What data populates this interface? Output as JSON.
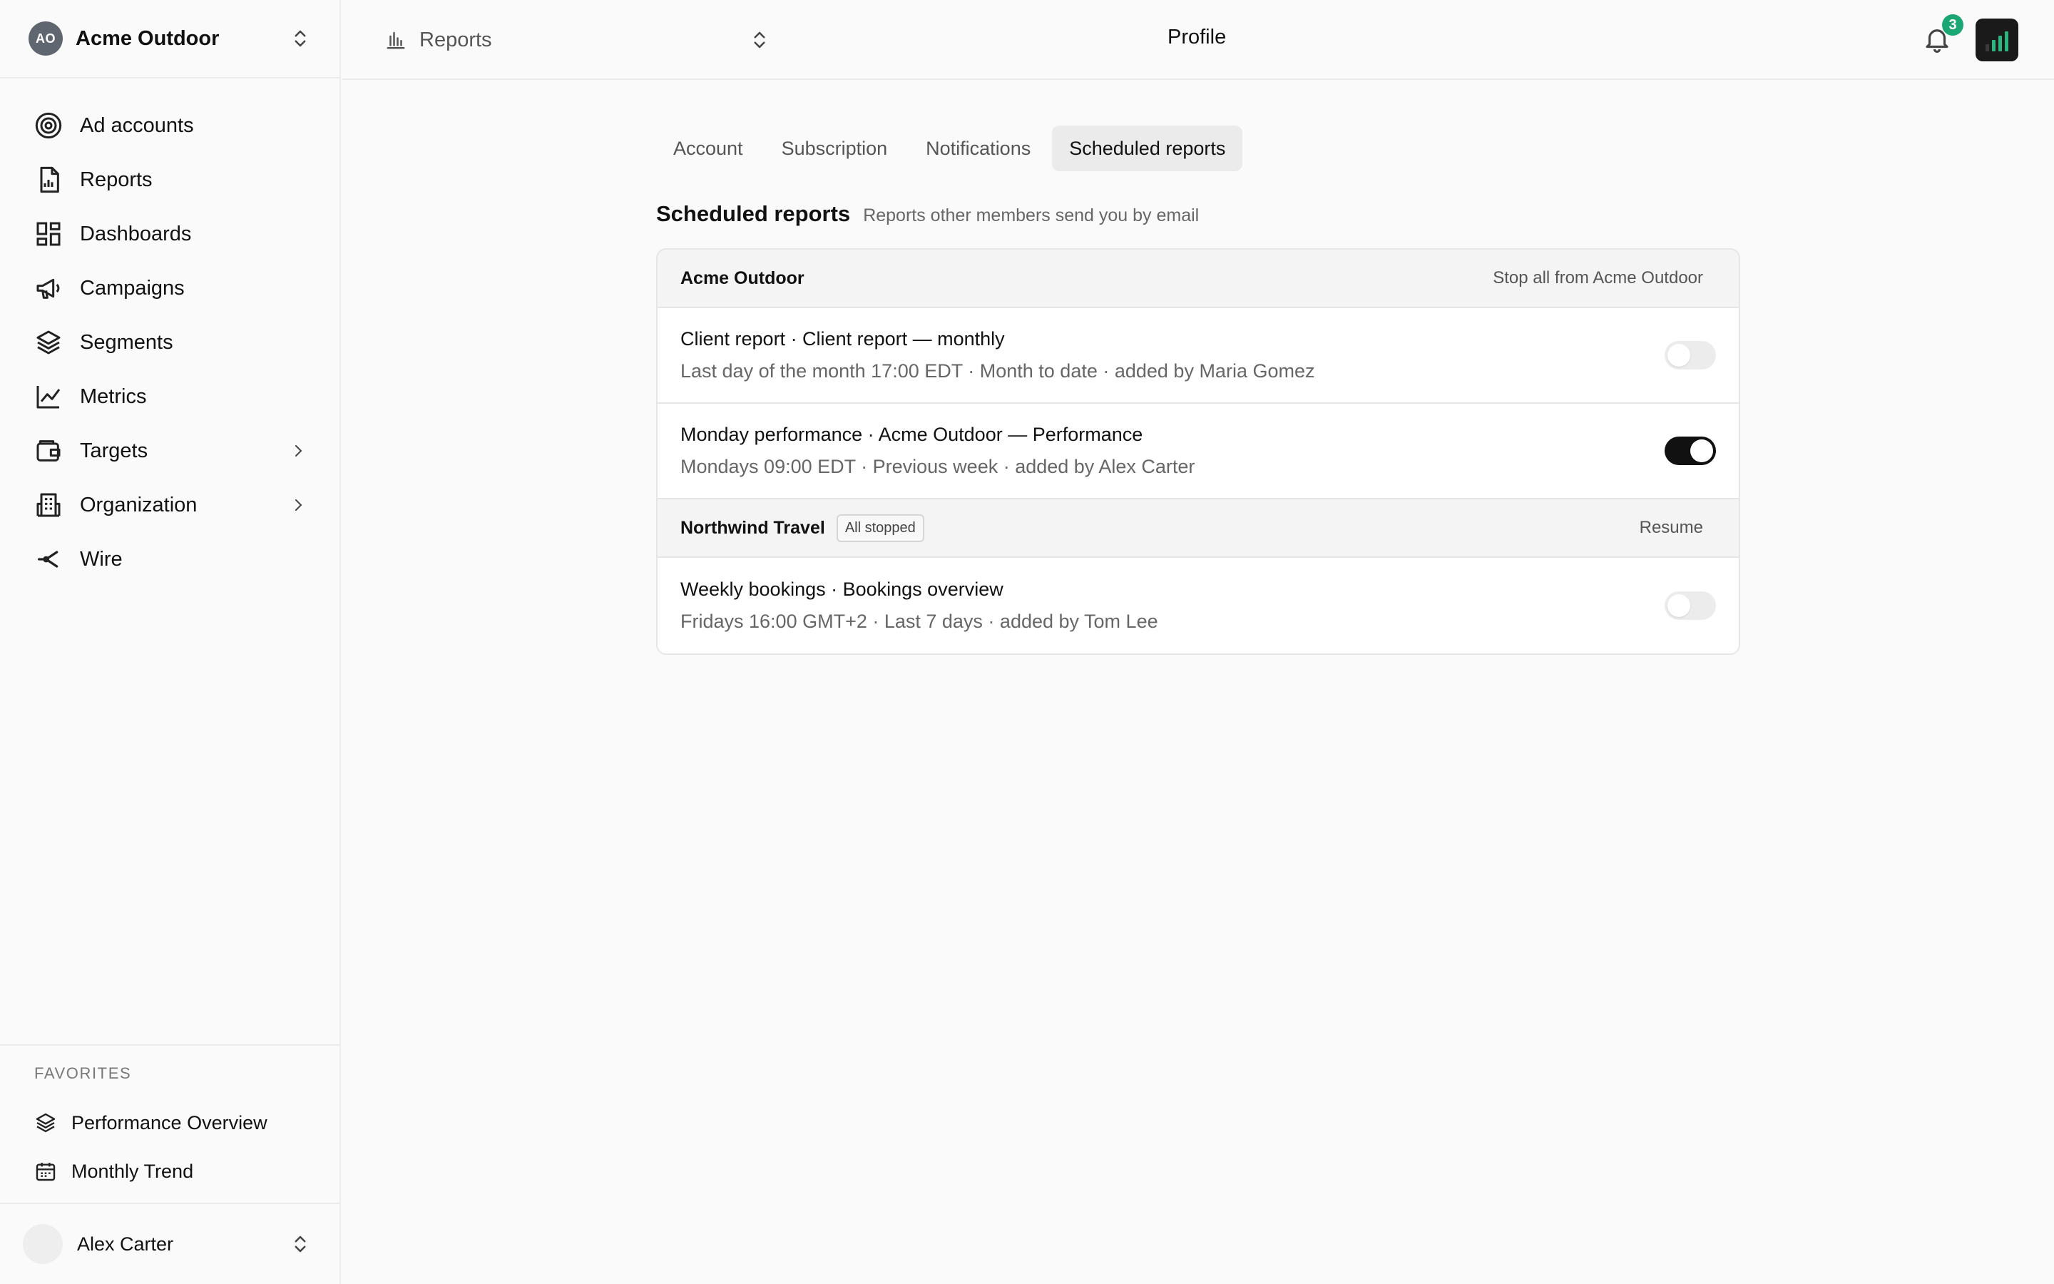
{
  "workspace": {
    "initials": "AO",
    "name": "Acme Outdoor"
  },
  "sidebar": {
    "items": [
      {
        "label": "Ad accounts",
        "icon": "target-icon"
      },
      {
        "label": "Reports",
        "icon": "report-icon"
      },
      {
        "label": "Dashboards",
        "icon": "dashboard-icon"
      },
      {
        "label": "Campaigns",
        "icon": "megaphone-icon"
      },
      {
        "label": "Segments",
        "icon": "layers-icon"
      },
      {
        "label": "Metrics",
        "icon": "line-chart-icon"
      },
      {
        "label": "Targets",
        "icon": "wallet-icon",
        "has_chevron": true
      },
      {
        "label": "Organization",
        "icon": "building-icon",
        "has_chevron": true
      },
      {
        "label": "Wire",
        "icon": "share-icon"
      }
    ],
    "favorites_heading": "FAVORITES",
    "favorites": [
      {
        "label": "Performance Overview",
        "icon": "layers-icon"
      },
      {
        "label": "Monthly Trend",
        "icon": "calendar-icon"
      }
    ],
    "user": {
      "name": "Alex Carter"
    }
  },
  "topbar": {
    "report_select": "Reports",
    "page_title": "Profile",
    "notification_count": "3"
  },
  "tabs": [
    {
      "label": "Account",
      "active": false
    },
    {
      "label": "Subscription",
      "active": false
    },
    {
      "label": "Notifications",
      "active": false
    },
    {
      "label": "Scheduled reports",
      "active": true
    }
  ],
  "section": {
    "title": "Scheduled reports",
    "subtitle": "Reports other members send you by email"
  },
  "groups": [
    {
      "name": "Acme Outdoor",
      "tag": "",
      "action": "Stop all from Acme Outdoor",
      "rows": [
        {
          "title": "Client report · Client report — monthly",
          "detail": "Last day of the month 17:00 EDT · Month to date · added by Maria Gomez",
          "enabled": false
        },
        {
          "title": "Monday performance · Acme Outdoor — Performance",
          "detail": "Mondays 09:00 EDT · Previous week · added by Alex Carter",
          "enabled": true
        }
      ]
    },
    {
      "name": "Northwind Travel",
      "tag": "All stopped",
      "action": "Resume",
      "rows": [
        {
          "title": "Weekly bookings · Bookings overview",
          "detail": "Fridays 16:00 GMT+2 · Last 7 days · added by Tom Lee",
          "enabled": false
        }
      ]
    }
  ],
  "colors": {
    "accent_badge": "#1aa774",
    "toggle_on": "#111111",
    "toggle_off": "#ececec"
  }
}
